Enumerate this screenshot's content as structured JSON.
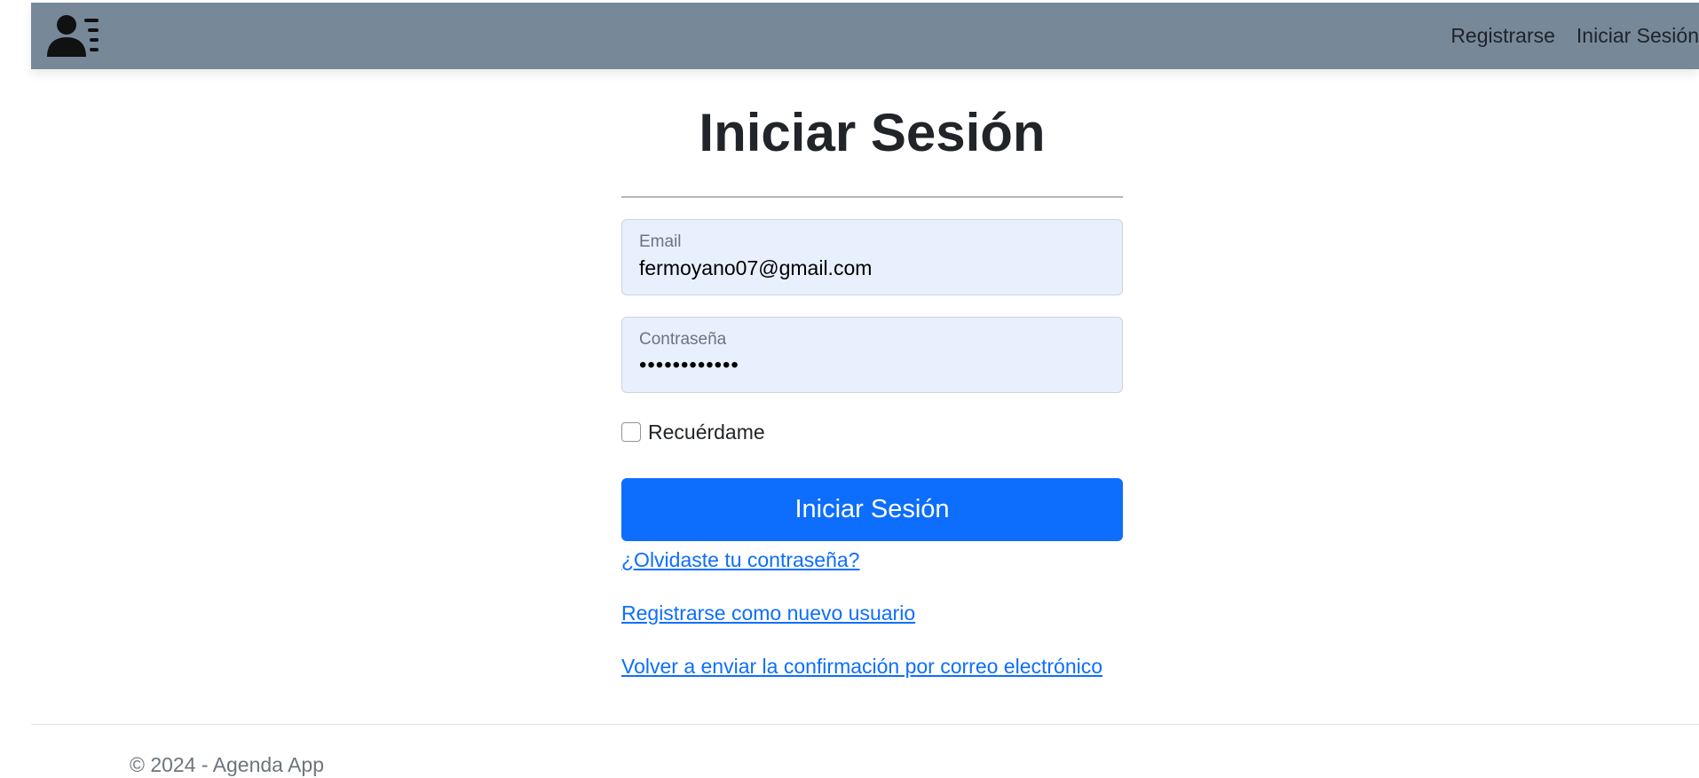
{
  "navbar": {
    "brand_icon": "contacts-icon",
    "links": [
      {
        "label": "Registrarse"
      },
      {
        "label": "Iniciar Sesión"
      }
    ],
    "background": "#778899"
  },
  "form": {
    "title": "Iniciar Sesión",
    "email": {
      "label": "Email",
      "value": "fermoyano07@gmail.com"
    },
    "password": {
      "label": "Contraseña",
      "masked_value": "••••••••••••"
    },
    "remember": {
      "label": "Recuérdame",
      "checked": false
    },
    "submit_label": "Iniciar Sesión",
    "submit_color": "#0d6efd",
    "field_background": "#e8f0fe",
    "links": [
      {
        "label": "¿Olvidaste tu contraseña?"
      },
      {
        "label": "Registrarse como nuevo usuario"
      },
      {
        "label": "Volver a enviar la confirmación por correo electrónico"
      }
    ]
  },
  "footer": {
    "text": "© 2024 - Agenda App"
  }
}
